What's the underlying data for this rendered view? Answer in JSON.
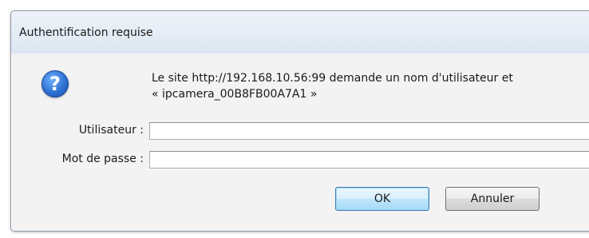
{
  "dialog": {
    "title": "Authentification requise",
    "icon": "question-icon",
    "message_line1": "Le site http://192.168.10.56:99 demande un nom d'utilisateur et",
    "message_line2": "« ipcamera_00B8FB00A7A1 »",
    "user_label": "Utilisateur :",
    "user_value": "",
    "password_label": "Mot de passe :",
    "password_value": "",
    "ok_label": "OK",
    "cancel_label": "Annuler"
  },
  "colors": {
    "title_bg": "#dce6f2",
    "body_bg": "#f3f3f3",
    "ok_accent": "#3c7fb1"
  }
}
